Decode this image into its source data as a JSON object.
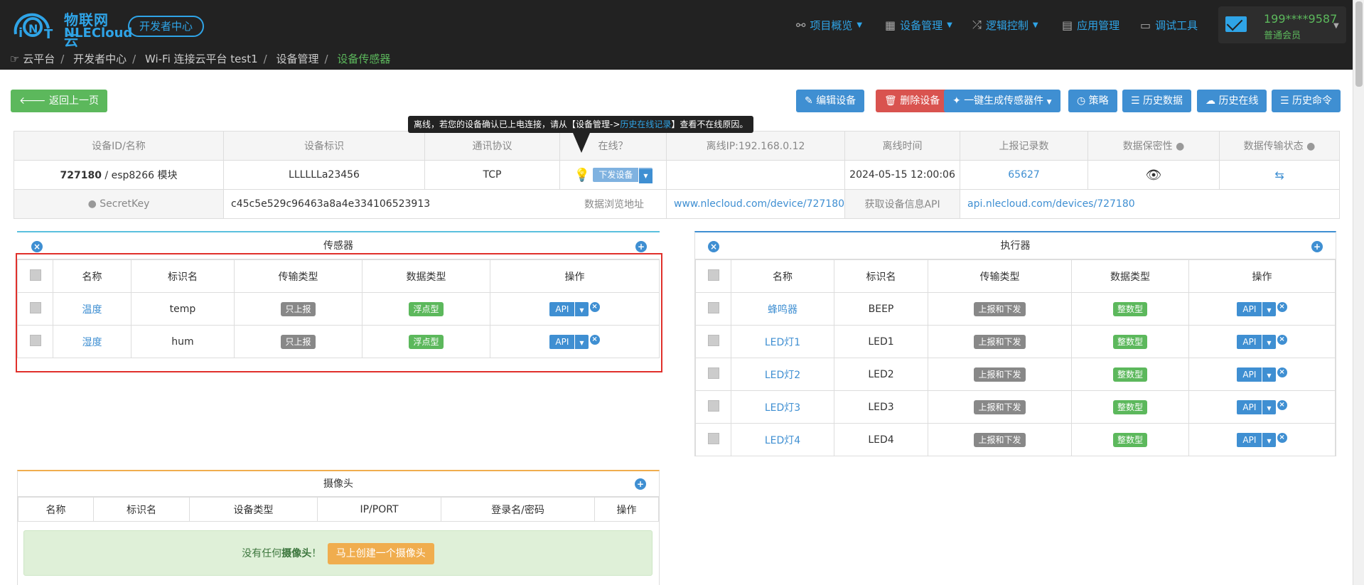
{
  "header": {
    "logo_cn": "物联网云",
    "logo_en": "NLECloud",
    "dev_center": "开发者中心",
    "nav": [
      {
        "label": "项目概览",
        "icon": "share-icon",
        "caret": true
      },
      {
        "label": "设备管理",
        "icon": "grid-icon",
        "caret": true
      },
      {
        "label": "逻辑控制",
        "icon": "shuffle-icon",
        "caret": true
      },
      {
        "label": "应用管理",
        "icon": "briefcase-icon",
        "caret": false
      },
      {
        "label": "调试工具",
        "icon": "laptop-icon",
        "caret": false
      }
    ],
    "user_phone": "199****9587",
    "user_level": "普通会员"
  },
  "breadcrumb": [
    "云平台",
    "开发者中心",
    "Wi-Fi 连接云平台 test1",
    "设备管理",
    "设备传感器"
  ],
  "toolbar": {
    "back": "返回上一页",
    "edit": "编辑设备",
    "delete": "删除设备",
    "generate": "一键生成传感器件",
    "strategy": "策略",
    "history_data": "历史数据",
    "history_online": "历史在线",
    "history_cmd": "历史命令"
  },
  "tooltip": {
    "pre": "离线，若您的设备确认已上电连接，请从【设备管理->",
    "link": "历史在线记录",
    "post": "】查看不在线原因。"
  },
  "info": {
    "headers": [
      "设备ID/名称",
      "设备标识",
      "通讯协议",
      "在线？",
      "离线IP:192.168.0.12",
      "离线时间",
      "上报记录数",
      "数据保密性",
      "数据传输状态"
    ],
    "device_id": "727180",
    "device_name": " / esp8266 模块",
    "device_tag": "LLLLLLa23456",
    "protocol": "TCP",
    "send_btn": "下发设备",
    "offline_time": "2024-05-15 12:00:06",
    "report_count": "65627",
    "secretkey_label": "SecretKey",
    "secretkey": "c45c5e529c96463a8a4e334106523913",
    "browse_label": "数据浏览地址",
    "browse_url": "www.nlecloud.com/device/727180",
    "api_label": "获取设备信息API",
    "api_url": "api.nlecloud.com/devices/727180"
  },
  "sensors": {
    "title": "传感器",
    "headers": [
      "名称",
      "标识名",
      "传输类型",
      "数据类型",
      "操作"
    ],
    "rows": [
      {
        "name": "温度",
        "tag": "temp",
        "trans": "只上报",
        "dtype": "浮点型",
        "op": "API"
      },
      {
        "name": "湿度",
        "tag": "hum",
        "trans": "只上报",
        "dtype": "浮点型",
        "op": "API"
      }
    ]
  },
  "actuators": {
    "title": "执行器",
    "headers": [
      "名称",
      "标识名",
      "传输类型",
      "数据类型",
      "操作"
    ],
    "rows": [
      {
        "name": "蜂鸣器",
        "tag": "BEEP",
        "trans": "上报和下发",
        "dtype": "整数型",
        "op": "API"
      },
      {
        "name": "LED灯1",
        "tag": "LED1",
        "trans": "上报和下发",
        "dtype": "整数型",
        "op": "API"
      },
      {
        "name": "LED灯2",
        "tag": "LED2",
        "trans": "上报和下发",
        "dtype": "整数型",
        "op": "API"
      },
      {
        "name": "LED灯3",
        "tag": "LED3",
        "trans": "上报和下发",
        "dtype": "整数型",
        "op": "API"
      },
      {
        "name": "LED灯4",
        "tag": "LED4",
        "trans": "上报和下发",
        "dtype": "整数型",
        "op": "API"
      }
    ]
  },
  "camera": {
    "title": "摄像头",
    "headers": [
      "名称",
      "标识名",
      "设备类型",
      "IP/PORT",
      "登录名/密码",
      "操作"
    ],
    "empty_pre": "没有任何",
    "empty_bold": "摄像头",
    "empty_post": "！",
    "create_btn": "马上创建一个摄像头"
  },
  "colors": {
    "accent": "#2fa4e7",
    "primary": "#3f8fd2",
    "danger": "#d9534f",
    "success": "#5cb85c",
    "warning": "#f0ad4e"
  }
}
